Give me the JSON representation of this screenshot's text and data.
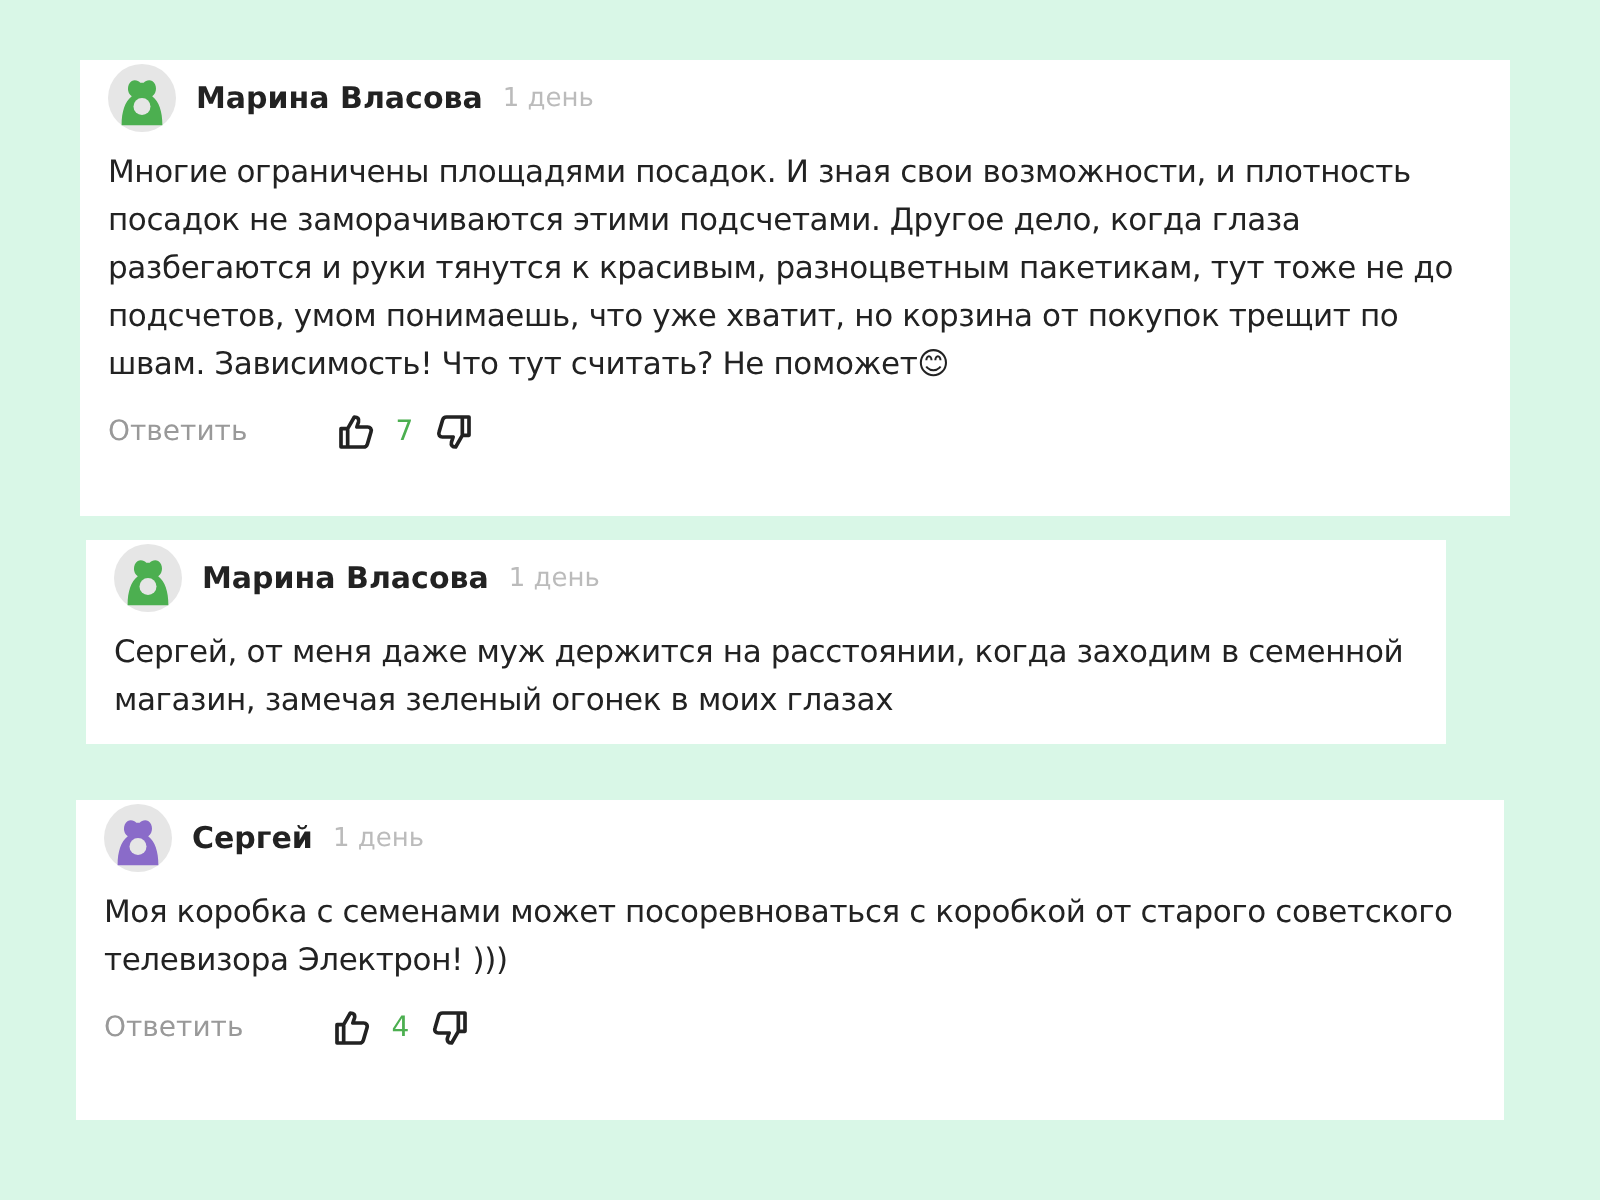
{
  "comments": [
    {
      "author": "Марина Власова",
      "time": "1 день",
      "color": "#4caf50",
      "text": "Многие ограничены площадями посадок. И зная свои возможности, и плотность посадок не заморачиваются этими подсчетами. Другое дело, когда глаза разбегаются и руки тянутся к красивым, разноцветным пакетикам, тут тоже не до подсчетов, умом понимаешь, что уже хватит, но корзина от покупок трещит по швам. Зависимость! Что тут считать? Не поможет😊",
      "actions": {
        "reply": "Ответить",
        "likes": "7"
      }
    },
    {
      "author": "Марина Власова",
      "time": "1 день",
      "color": "#4caf50",
      "text": "Сергей, от меня даже муж держится на расстоянии, когда заходим в семенной магазин, замечая зеленый огонек в моих глазах"
    },
    {
      "author": "Сергей",
      "time": "1 день",
      "color": "#8a6bc9",
      "text": "Моя коробка с семенами может посоревноваться с коробкой от старого советского телевизора Электрон! )))",
      "actions": {
        "reply": "Ответить",
        "likes": "4"
      }
    }
  ]
}
